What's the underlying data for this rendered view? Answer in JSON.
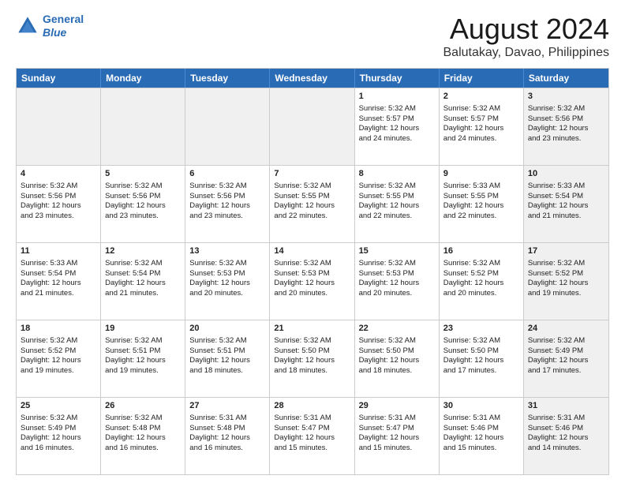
{
  "header": {
    "logo_line1": "General",
    "logo_line2": "Blue",
    "month": "August 2024",
    "location": "Balutakay, Davao, Philippines"
  },
  "weekdays": [
    "Sunday",
    "Monday",
    "Tuesday",
    "Wednesday",
    "Thursday",
    "Friday",
    "Saturday"
  ],
  "rows": [
    [
      {
        "day": "",
        "info": "",
        "shaded": true
      },
      {
        "day": "",
        "info": "",
        "shaded": true
      },
      {
        "day": "",
        "info": "",
        "shaded": true
      },
      {
        "day": "",
        "info": "",
        "shaded": true
      },
      {
        "day": "1",
        "info": "Sunrise: 5:32 AM\nSunset: 5:57 PM\nDaylight: 12 hours\nand 24 minutes.",
        "shaded": false
      },
      {
        "day": "2",
        "info": "Sunrise: 5:32 AM\nSunset: 5:57 PM\nDaylight: 12 hours\nand 24 minutes.",
        "shaded": false
      },
      {
        "day": "3",
        "info": "Sunrise: 5:32 AM\nSunset: 5:56 PM\nDaylight: 12 hours\nand 23 minutes.",
        "shaded": true
      }
    ],
    [
      {
        "day": "4",
        "info": "Sunrise: 5:32 AM\nSunset: 5:56 PM\nDaylight: 12 hours\nand 23 minutes.",
        "shaded": false
      },
      {
        "day": "5",
        "info": "Sunrise: 5:32 AM\nSunset: 5:56 PM\nDaylight: 12 hours\nand 23 minutes.",
        "shaded": false
      },
      {
        "day": "6",
        "info": "Sunrise: 5:32 AM\nSunset: 5:56 PM\nDaylight: 12 hours\nand 23 minutes.",
        "shaded": false
      },
      {
        "day": "7",
        "info": "Sunrise: 5:32 AM\nSunset: 5:55 PM\nDaylight: 12 hours\nand 22 minutes.",
        "shaded": false
      },
      {
        "day": "8",
        "info": "Sunrise: 5:32 AM\nSunset: 5:55 PM\nDaylight: 12 hours\nand 22 minutes.",
        "shaded": false
      },
      {
        "day": "9",
        "info": "Sunrise: 5:33 AM\nSunset: 5:55 PM\nDaylight: 12 hours\nand 22 minutes.",
        "shaded": false
      },
      {
        "day": "10",
        "info": "Sunrise: 5:33 AM\nSunset: 5:54 PM\nDaylight: 12 hours\nand 21 minutes.",
        "shaded": true
      }
    ],
    [
      {
        "day": "11",
        "info": "Sunrise: 5:33 AM\nSunset: 5:54 PM\nDaylight: 12 hours\nand 21 minutes.",
        "shaded": false
      },
      {
        "day": "12",
        "info": "Sunrise: 5:32 AM\nSunset: 5:54 PM\nDaylight: 12 hours\nand 21 minutes.",
        "shaded": false
      },
      {
        "day": "13",
        "info": "Sunrise: 5:32 AM\nSunset: 5:53 PM\nDaylight: 12 hours\nand 20 minutes.",
        "shaded": false
      },
      {
        "day": "14",
        "info": "Sunrise: 5:32 AM\nSunset: 5:53 PM\nDaylight: 12 hours\nand 20 minutes.",
        "shaded": false
      },
      {
        "day": "15",
        "info": "Sunrise: 5:32 AM\nSunset: 5:53 PM\nDaylight: 12 hours\nand 20 minutes.",
        "shaded": false
      },
      {
        "day": "16",
        "info": "Sunrise: 5:32 AM\nSunset: 5:52 PM\nDaylight: 12 hours\nand 20 minutes.",
        "shaded": false
      },
      {
        "day": "17",
        "info": "Sunrise: 5:32 AM\nSunset: 5:52 PM\nDaylight: 12 hours\nand 19 minutes.",
        "shaded": true
      }
    ],
    [
      {
        "day": "18",
        "info": "Sunrise: 5:32 AM\nSunset: 5:52 PM\nDaylight: 12 hours\nand 19 minutes.",
        "shaded": false
      },
      {
        "day": "19",
        "info": "Sunrise: 5:32 AM\nSunset: 5:51 PM\nDaylight: 12 hours\nand 19 minutes.",
        "shaded": false
      },
      {
        "day": "20",
        "info": "Sunrise: 5:32 AM\nSunset: 5:51 PM\nDaylight: 12 hours\nand 18 minutes.",
        "shaded": false
      },
      {
        "day": "21",
        "info": "Sunrise: 5:32 AM\nSunset: 5:50 PM\nDaylight: 12 hours\nand 18 minutes.",
        "shaded": false
      },
      {
        "day": "22",
        "info": "Sunrise: 5:32 AM\nSunset: 5:50 PM\nDaylight: 12 hours\nand 18 minutes.",
        "shaded": false
      },
      {
        "day": "23",
        "info": "Sunrise: 5:32 AM\nSunset: 5:50 PM\nDaylight: 12 hours\nand 17 minutes.",
        "shaded": false
      },
      {
        "day": "24",
        "info": "Sunrise: 5:32 AM\nSunset: 5:49 PM\nDaylight: 12 hours\nand 17 minutes.",
        "shaded": true
      }
    ],
    [
      {
        "day": "25",
        "info": "Sunrise: 5:32 AM\nSunset: 5:49 PM\nDaylight: 12 hours\nand 16 minutes.",
        "shaded": false
      },
      {
        "day": "26",
        "info": "Sunrise: 5:32 AM\nSunset: 5:48 PM\nDaylight: 12 hours\nand 16 minutes.",
        "shaded": false
      },
      {
        "day": "27",
        "info": "Sunrise: 5:31 AM\nSunset: 5:48 PM\nDaylight: 12 hours\nand 16 minutes.",
        "shaded": false
      },
      {
        "day": "28",
        "info": "Sunrise: 5:31 AM\nSunset: 5:47 PM\nDaylight: 12 hours\nand 15 minutes.",
        "shaded": false
      },
      {
        "day": "29",
        "info": "Sunrise: 5:31 AM\nSunset: 5:47 PM\nDaylight: 12 hours\nand 15 minutes.",
        "shaded": false
      },
      {
        "day": "30",
        "info": "Sunrise: 5:31 AM\nSunset: 5:46 PM\nDaylight: 12 hours\nand 15 minutes.",
        "shaded": false
      },
      {
        "day": "31",
        "info": "Sunrise: 5:31 AM\nSunset: 5:46 PM\nDaylight: 12 hours\nand 14 minutes.",
        "shaded": true
      }
    ]
  ]
}
